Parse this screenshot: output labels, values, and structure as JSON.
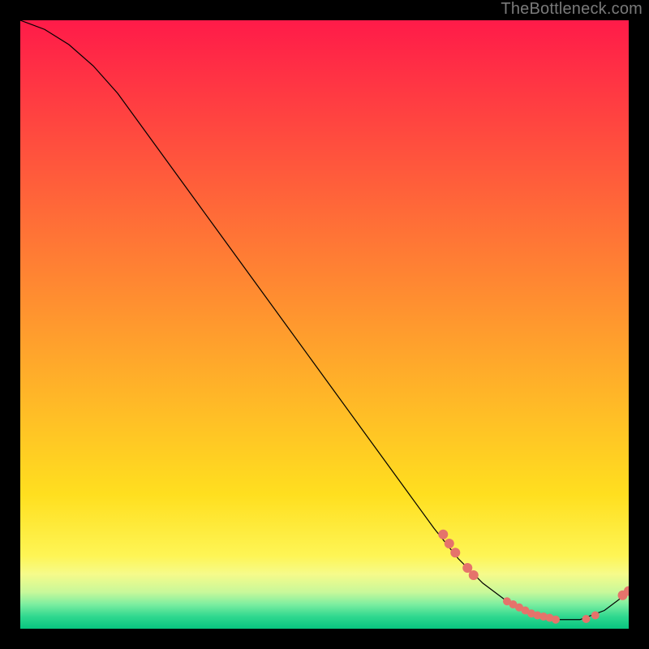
{
  "watermark": "TheBottleneck.com",
  "chart_data": {
    "type": "line",
    "title": "",
    "xlabel": "",
    "ylabel": "",
    "xlim": [
      0,
      100
    ],
    "ylim": [
      0,
      100
    ],
    "grid": false,
    "legend": false,
    "series": [
      {
        "name": "curve",
        "x": [
          0,
          4,
          8,
          12,
          16,
          20,
          24,
          28,
          32,
          36,
          40,
          44,
          48,
          52,
          56,
          60,
          64,
          68,
          72,
          76,
          80,
          84,
          88,
          92,
          96,
          100
        ],
        "y": [
          100,
          98.5,
          96,
          92.5,
          88,
          82.5,
          77,
          71.5,
          66,
          60.5,
          55,
          49.5,
          44,
          38.5,
          33,
          27.5,
          22,
          16.5,
          11.5,
          7.5,
          4.5,
          2.5,
          1.5,
          1.5,
          3,
          6
        ],
        "stroke": "#000000",
        "stroke_width": 1.2
      }
    ],
    "markers": [
      {
        "x": 69.5,
        "y": 15.5,
        "r": 6,
        "fill": "#e5736b"
      },
      {
        "x": 70.5,
        "y": 14.0,
        "r": 6,
        "fill": "#e5736b"
      },
      {
        "x": 71.5,
        "y": 12.5,
        "r": 6,
        "fill": "#e5736b"
      },
      {
        "x": 73.5,
        "y": 10.0,
        "r": 6,
        "fill": "#e5736b"
      },
      {
        "x": 74.5,
        "y": 8.8,
        "r": 6,
        "fill": "#e5736b"
      },
      {
        "x": 80.0,
        "y": 4.5,
        "r": 5,
        "fill": "#e5736b"
      },
      {
        "x": 81.0,
        "y": 4.0,
        "r": 5,
        "fill": "#e5736b"
      },
      {
        "x": 82.0,
        "y": 3.5,
        "r": 5,
        "fill": "#e5736b"
      },
      {
        "x": 83.0,
        "y": 3.0,
        "r": 5,
        "fill": "#e5736b"
      },
      {
        "x": 84.0,
        "y": 2.5,
        "r": 5,
        "fill": "#e5736b"
      },
      {
        "x": 85.0,
        "y": 2.2,
        "r": 5,
        "fill": "#e5736b"
      },
      {
        "x": 86.0,
        "y": 2.0,
        "r": 5,
        "fill": "#e5736b"
      },
      {
        "x": 87.0,
        "y": 1.8,
        "r": 5,
        "fill": "#e5736b"
      },
      {
        "x": 88.0,
        "y": 1.5,
        "r": 5,
        "fill": "#e5736b"
      },
      {
        "x": 93.0,
        "y": 1.6,
        "r": 5,
        "fill": "#e5736b"
      },
      {
        "x": 94.5,
        "y": 2.2,
        "r": 5,
        "fill": "#e5736b"
      },
      {
        "x": 99.0,
        "y": 5.5,
        "r": 6,
        "fill": "#e5736b"
      },
      {
        "x": 100.0,
        "y": 6.2,
        "r": 6,
        "fill": "#e5736b"
      }
    ],
    "gradient_bands": [
      {
        "y0": 100,
        "y1": 22,
        "c0": "#ff1b49",
        "c1": "#ffdf1f"
      },
      {
        "y0": 22,
        "y1": 12,
        "c0": "#ffdf1f",
        "c1": "#fef555"
      },
      {
        "y0": 12,
        "y1": 9,
        "c0": "#fef555",
        "c1": "#f6fb8a"
      },
      {
        "y0": 9,
        "y1": 6,
        "c0": "#f6fb8a",
        "c1": "#c8f89a"
      },
      {
        "y0": 6,
        "y1": 4,
        "c0": "#c8f89a",
        "c1": "#7ceea0"
      },
      {
        "y0": 4,
        "y1": 2,
        "c0": "#7ceea0",
        "c1": "#2fd88f"
      },
      {
        "y0": 2,
        "y1": 0,
        "c0": "#2fd88f",
        "c1": "#08c57f"
      }
    ]
  }
}
